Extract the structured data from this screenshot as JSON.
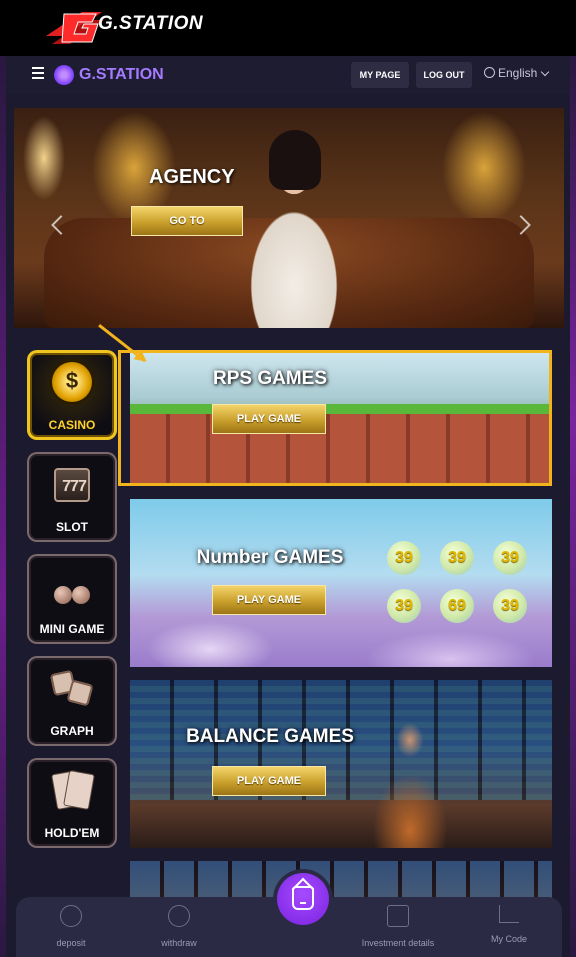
{
  "brand": {
    "logo_text": "G.STATION"
  },
  "header": {
    "logo_text": "G.STATION",
    "my_page_label": "MY PAGE",
    "logout_label": "LOG OUT",
    "language": "English"
  },
  "hero": {
    "title": "AGENCY",
    "button_label": "GO TO"
  },
  "categories": [
    {
      "label": "CASINO",
      "icon": "casino-chip-icon",
      "active": true
    },
    {
      "label": "SLOT",
      "icon": "slot-777-icon",
      "active": false
    },
    {
      "label": "MINI GAME",
      "icon": "cherry-icon",
      "active": false
    },
    {
      "label": "GRAPH",
      "icon": "dice-icon",
      "active": false
    },
    {
      "label": "HOLD'EM",
      "icon": "playing-cards-icon",
      "active": false
    }
  ],
  "games": [
    {
      "title": "RPS GAMES",
      "button_label": "PLAY GAME"
    },
    {
      "title": "Number GAMES",
      "button_label": "PLAY GAME",
      "balls": [
        "39",
        "39",
        "39",
        "39",
        "69",
        "39"
      ]
    },
    {
      "title": "BALANCE GAMES",
      "button_label": "PLAY GAME"
    }
  ],
  "bottom_nav": {
    "deposit": "deposit",
    "withdraw": "withdraw",
    "investment": "Investment details",
    "my_code": "My Code"
  },
  "colors": {
    "accent_purple": "#7a22e0",
    "highlight_gold": "#f2b41c",
    "button_gold": "#c9a02c",
    "background": "#1c1a2e"
  }
}
